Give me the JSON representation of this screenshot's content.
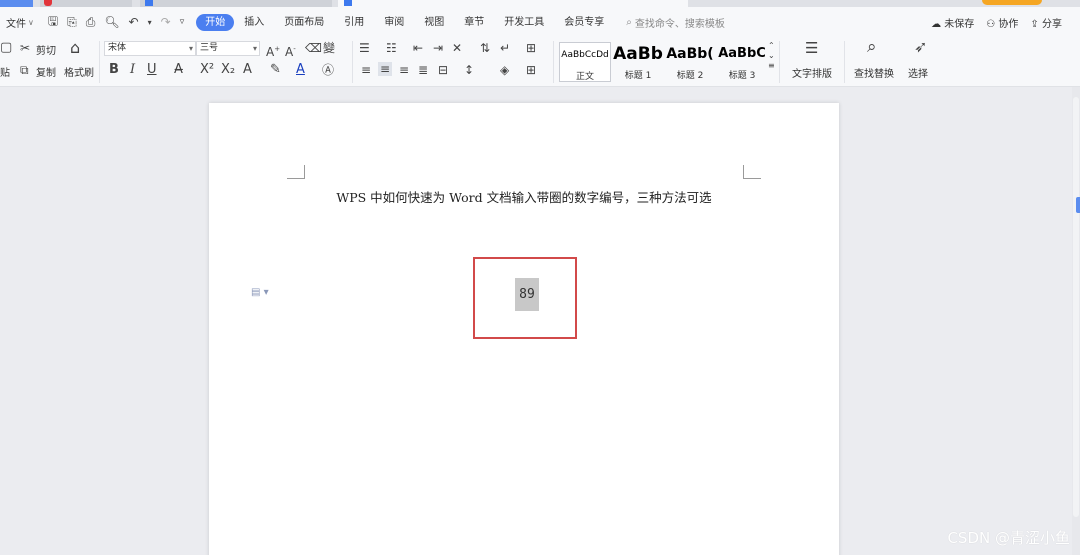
{
  "menu": {
    "file_label": "文件",
    "tabs": [
      "开始",
      "插入",
      "页面布局",
      "引用",
      "审阅",
      "视图",
      "章节",
      "开发工具",
      "会员专享"
    ],
    "active_tab": "开始",
    "search_placeholder": "查找命令、搜索模板",
    "right": {
      "unsaved": "未保存",
      "collab": "协作",
      "share": "分享"
    }
  },
  "ribbon": {
    "cut": "剪切",
    "copy": "复制",
    "format_painter": "格式刷",
    "paste_partial": "贴",
    "font_name": "宋体",
    "font_size": "三号",
    "styles": [
      {
        "sample": "AaBbCcDd",
        "label": "正文"
      },
      {
        "sample": "AaBb",
        "label": "标题 1"
      },
      {
        "sample": "AaBb(",
        "label": "标题 2"
      },
      {
        "sample": "AaBbC",
        "label": "标题 3"
      }
    ],
    "text_layout": "文字排版",
    "find_replace": "查找替换",
    "select": "选择"
  },
  "document": {
    "title": "WPS 中如何快速为 Word 文档输入带圈的数字编号，三种方法可选",
    "selected_number": "89"
  },
  "watermark": "CSDN @青涩小鱼"
}
